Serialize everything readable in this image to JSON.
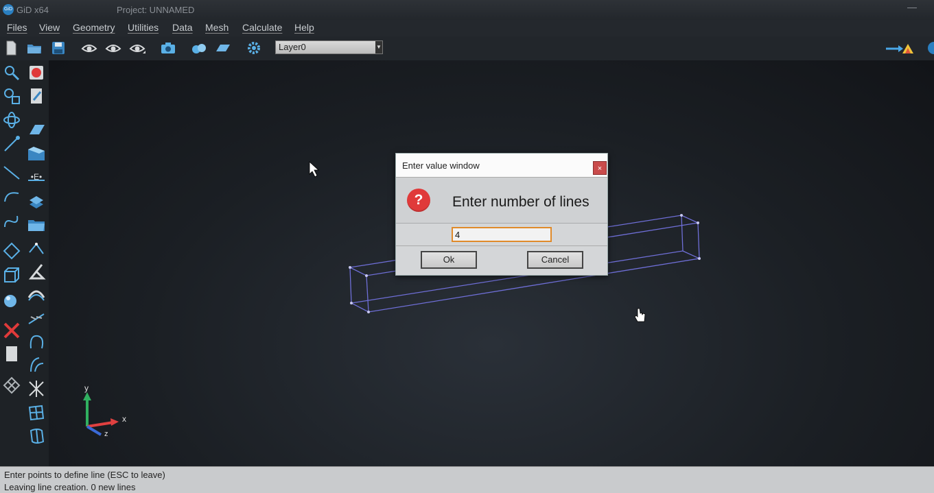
{
  "app": {
    "name": "GiD x64",
    "logo_text": "GiD",
    "project_title": "Project: UNNAMED",
    "minimize_glyph": "—"
  },
  "menu": {
    "items": [
      "Files",
      "View",
      "Geometry",
      "Utilities",
      "Data",
      "Mesh",
      "Calculate",
      "Help"
    ]
  },
  "toolbar": {
    "layer_select": "Layer0",
    "icons": [
      "new-file-icon",
      "open-folder-icon",
      "save-icon",
      "view-eye-icon",
      "view-eye-2-icon",
      "view-eye-3-icon",
      "camera-icon",
      "render-icon",
      "plane-icon",
      "settings-gear-icon",
      "arrow-right-icon",
      "rainbow-icon",
      "gid-logo-icon"
    ]
  },
  "left_toolbar": {
    "icons": [
      "zoom-in-icon",
      "zoom-box-icon",
      "rotate-icon",
      "pick-icon",
      "line-icon",
      "arc-icon",
      "nurbs-icon",
      "surface-icon",
      "volume-icon",
      "sphere-icon",
      "delete-icon",
      "document-icon",
      "mesh-icon",
      "record-icon",
      "edit-icon",
      "eraser-icon",
      "surface-tool-icon",
      "entity-icon",
      "layer-stack-icon",
      "folder-icon",
      "polyline-icon",
      "triangle-icon",
      "dome-icon",
      "divide-icon",
      "curve-icon",
      "curve-2-icon",
      "intersect-icon",
      "grid-icon",
      "grid-2-icon"
    ]
  },
  "dialog": {
    "title": "Enter value window",
    "close_glyph": "×",
    "question_glyph": "?",
    "message": "Enter number of lines",
    "input_value": "4",
    "ok_label": "Ok",
    "cancel_label": "Cancel"
  },
  "axes": {
    "x": "x",
    "y": "y",
    "z": "z"
  },
  "status": {
    "line1": "Enter points to define line (ESC to leave)",
    "line2": "Leaving line creation. 0 new lines"
  },
  "colors": {
    "wireframe": "#6f6fd8",
    "dialog_icon": "#e03a3a",
    "input_focus": "#e08a2a"
  }
}
